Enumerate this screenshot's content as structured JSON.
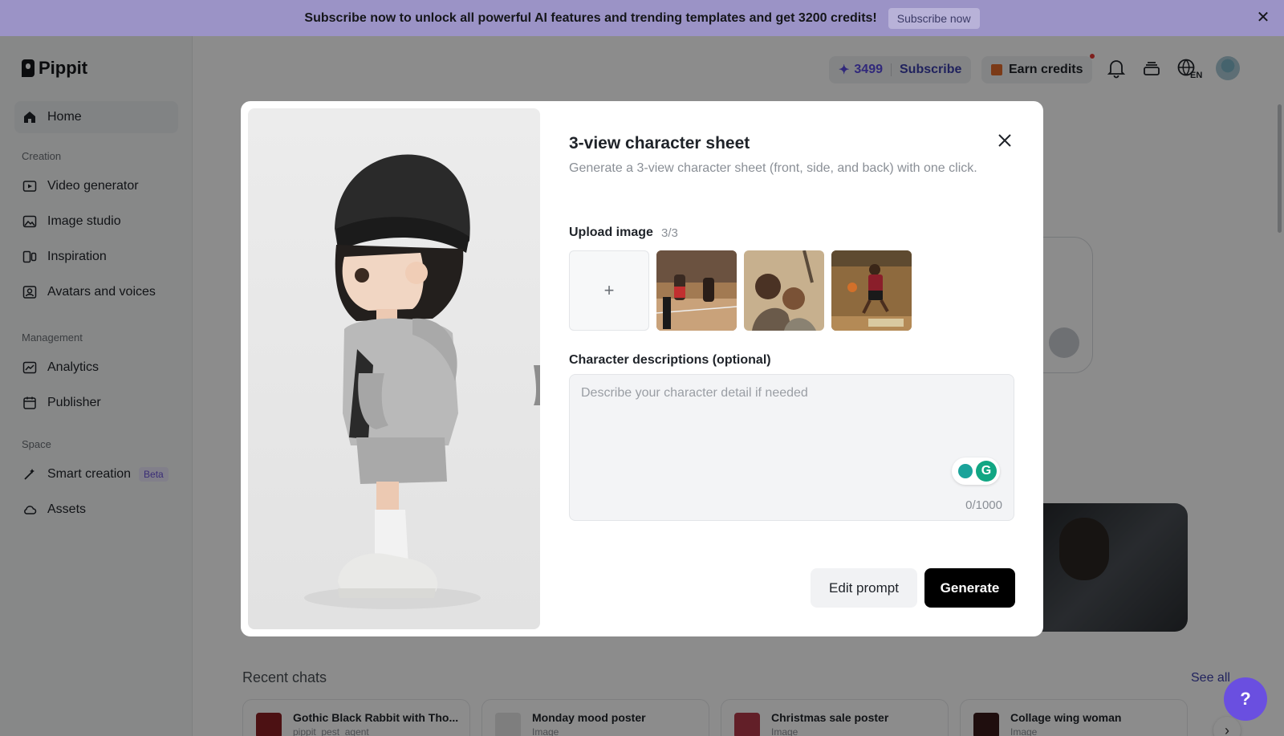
{
  "banner": {
    "text": "Subscribe now to unlock all powerful AI features and trending templates and get 3200 credits!",
    "button": "Subscribe now",
    "color": "#9b93c6"
  },
  "app": {
    "name": "Pippit"
  },
  "sidebar": {
    "home": "Home",
    "sections": {
      "creation": "Creation",
      "management": "Management",
      "space": "Space"
    },
    "creation_items": [
      "Video generator",
      "Image studio",
      "Inspiration",
      "Avatars and voices"
    ],
    "management_items": [
      "Analytics",
      "Publisher"
    ],
    "space_items": [
      "Smart creation",
      "Assets"
    ],
    "beta_badge": "Beta"
  },
  "header": {
    "credits": "3499",
    "subscribe": "Subscribe",
    "earn_credits": "Earn credits",
    "accent": "#5a4be0"
  },
  "modal": {
    "title": "3-view character sheet",
    "description": "Generate a 3-view character sheet (front, side, and back) with one click.",
    "upload_label": "Upload image",
    "upload_count": "3/3",
    "add_symbol": "+",
    "desc_label": "Character descriptions (optional)",
    "desc_placeholder": "Describe your character detail if needed",
    "char_count": "0/1000",
    "edit_prompt": "Edit prompt",
    "generate": "Generate"
  },
  "recent": {
    "title": "Recent chats",
    "see_all": "See all",
    "chats": [
      {
        "title": "Gothic Black Rabbit with Tho...",
        "sub": "pippit_pest_agent"
      },
      {
        "title": "Monday mood poster",
        "sub": "Image"
      },
      {
        "title": "Christmas sale poster",
        "sub": "Image"
      },
      {
        "title": "Collage wing woman",
        "sub": "Image"
      }
    ]
  },
  "icons": {
    "bell": "bell-icon",
    "layers": "stack-icon",
    "language": "globe-icon",
    "language_code": "EN",
    "help": "?"
  }
}
